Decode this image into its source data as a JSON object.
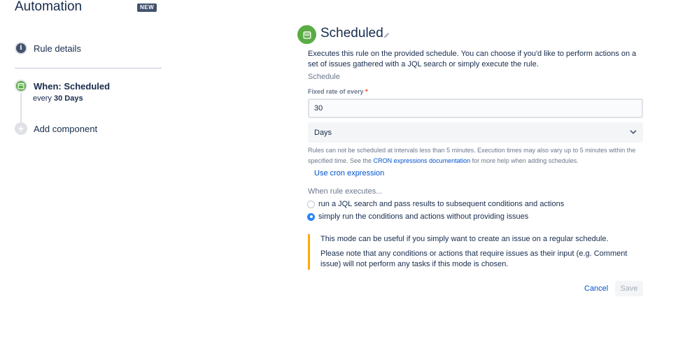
{
  "app": {
    "title": "Automation",
    "badge": "NEW"
  },
  "left_nav": {
    "rule_details": "Rule details",
    "trigger": {
      "title": "When: Scheduled",
      "sub_prefix": "every",
      "sub_value": "30 Days"
    },
    "add_component": "Add component"
  },
  "panel": {
    "title": "Scheduled",
    "description": "Executes this rule on the provided schedule. You can choose if you'd like to perform actions on a set of issues gathered with a JQL search or simply execute the rule.",
    "section_label": "Schedule",
    "rate_label": "Fixed rate of every",
    "required_mark": "*",
    "rate_value": "30",
    "unit_value": "Days",
    "help_text_1": "Rules can not be scheduled at intervals less than 5 minutes. Execution times may also vary up to 5 minutes within the specified time. See the",
    "help_link": "CRON expressions documentation",
    "help_text_2": "for more help when adding schedules.",
    "cron_link": "Use cron expression",
    "execute_label": "When rule executes...",
    "options": [
      {
        "label": "run a JQL search and pass results to subsequent conditions and actions",
        "selected": false
      },
      {
        "label": "simply run the conditions and actions without providing issues",
        "selected": true
      }
    ],
    "note_1": "This mode can be useful if you simply want to create an issue on a regular schedule.",
    "note_2": "Please note that any conditions or actions that require issues as their input (e.g. Comment issue) will not perform any tasks if this mode is chosen.",
    "cancel_label": "Cancel",
    "save_label": "Save"
  },
  "icons": {
    "info": "info-icon",
    "calendar": "calendar-icon",
    "add": "plus-icon",
    "edit": "pencil-icon",
    "dropdown": "chevron-down-icon"
  },
  "colors": {
    "trigger_green": "#5aac44",
    "link_blue": "#0052cc",
    "radio_blue": "#2684ff",
    "note_accent": "#ffab00",
    "badge_bg": "#42526e"
  }
}
